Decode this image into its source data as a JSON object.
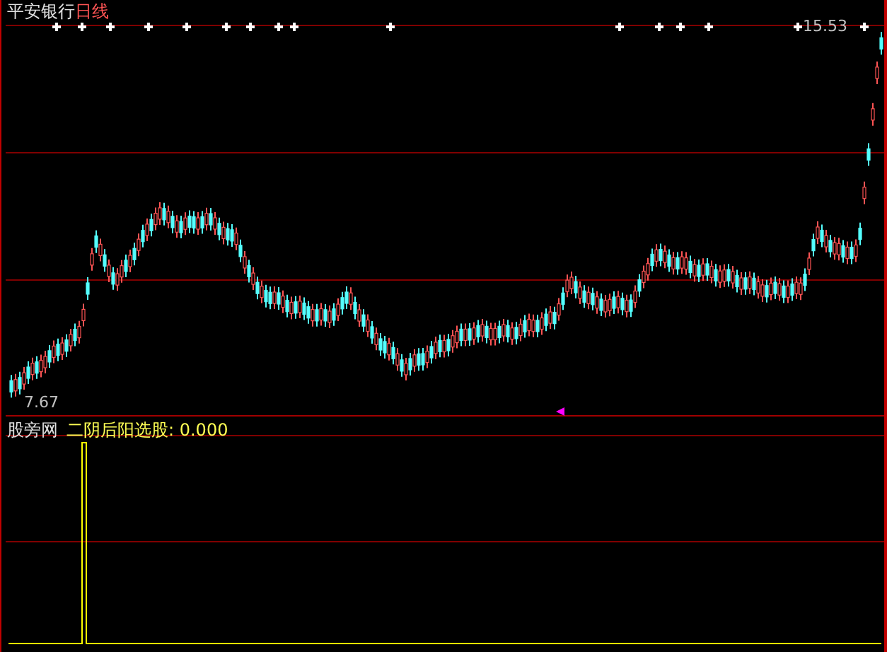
{
  "title": {
    "stock": "平安银行",
    "period": "日线"
  },
  "price_chart": {
    "high_label": "15.53",
    "low_label": "7.67"
  },
  "indicator": {
    "name": "股旁网",
    "formula": "二阴后阳选股:",
    "value": "0.000"
  }
}
